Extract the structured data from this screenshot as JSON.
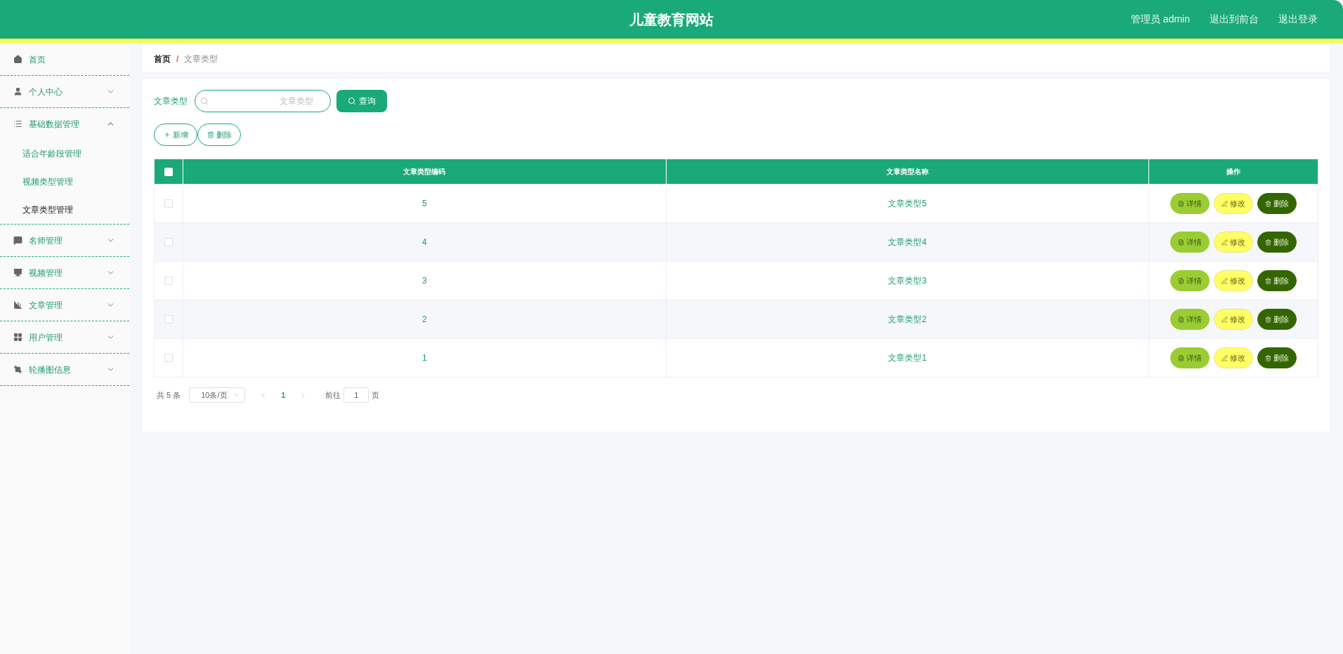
{
  "header": {
    "title": "儿童教育网站",
    "links": [
      "管理员 admin",
      "退出到前台",
      "退出登录"
    ]
  },
  "sidebar": {
    "items": [
      {
        "label": "首页"
      },
      {
        "label": "个人中心",
        "expanded": false
      },
      {
        "label": "基础数据管理",
        "expanded": true,
        "children": [
          {
            "label": "适合年龄段管理",
            "selected": false
          },
          {
            "label": "视频类型管理",
            "selected": false
          },
          {
            "label": "文章类型管理",
            "selected": true
          }
        ]
      },
      {
        "label": "名师管理",
        "expanded": false
      },
      {
        "label": "视频管理",
        "expanded": false
      },
      {
        "label": "文章管理",
        "expanded": false
      },
      {
        "label": "用户管理",
        "expanded": false
      },
      {
        "label": "轮播图信息",
        "expanded": false
      }
    ]
  },
  "breadcrumb": [
    "首页",
    "/",
    "文章类型"
  ],
  "search": {
    "label": "文章类型",
    "placeholder": "文章类型",
    "button": "查询"
  },
  "toolbar": [
    "新增",
    "删除"
  ],
  "table": {
    "all_checked": false,
    "columns": [
      "文章类型编码",
      "文章类型名称",
      "操作"
    ],
    "rows": [
      {
        "checked": false,
        "cells": [
          "5",
          "文章类型5"
        ],
        "actions": [
          {
            "kind": "detail",
            "label": "详情"
          },
          {
            "kind": "edit",
            "label": "修改"
          },
          {
            "kind": "delete",
            "label": "删除"
          }
        ]
      },
      {
        "checked": false,
        "cells": [
          "4",
          "文章类型4"
        ],
        "actions": [
          {
            "kind": "detail",
            "label": "详情"
          },
          {
            "kind": "edit",
            "label": "修改"
          },
          {
            "kind": "delete",
            "label": "删除"
          }
        ]
      },
      {
        "checked": false,
        "cells": [
          "3",
          "文章类型3"
        ],
        "actions": [
          {
            "kind": "detail",
            "label": "详情"
          },
          {
            "kind": "edit",
            "label": "修改"
          },
          {
            "kind": "delete",
            "label": "删除"
          }
        ]
      },
      {
        "checked": false,
        "cells": [
          "2",
          "文章类型2"
        ],
        "actions": [
          {
            "kind": "detail",
            "label": "详情"
          },
          {
            "kind": "edit",
            "label": "修改"
          },
          {
            "kind": "delete",
            "label": "删除"
          }
        ]
      },
      {
        "checked": false,
        "cells": [
          "1",
          "文章类型1"
        ],
        "actions": [
          {
            "kind": "detail",
            "label": "详情"
          },
          {
            "kind": "edit",
            "label": "修改"
          },
          {
            "kind": "delete",
            "label": "删除"
          }
        ]
      }
    ]
  },
  "pagination": {
    "total": "共 5 条",
    "page_size": "10条/页",
    "pages": [
      {
        "label": "1",
        "selected": true
      }
    ],
    "goto_label": "前往",
    "goto_value": "1",
    "goto_unit": "页"
  }
}
